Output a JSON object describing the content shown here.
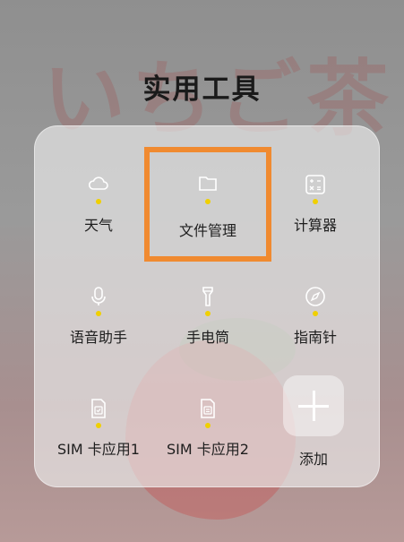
{
  "wallpaper": {
    "text": "いちご茶"
  },
  "folder": {
    "title": "实用工具"
  },
  "apps": [
    {
      "label": "天气",
      "icon": "cloud-icon"
    },
    {
      "label": "文件管理",
      "icon": "folder-icon"
    },
    {
      "label": "计算器",
      "icon": "calculator-icon"
    },
    {
      "label": "语音助手",
      "icon": "microphone-icon"
    },
    {
      "label": "手电筒",
      "icon": "flashlight-icon"
    },
    {
      "label": "指南针",
      "icon": "compass-icon"
    },
    {
      "label": "SIM 卡应用1",
      "icon": "sim-card-icon"
    },
    {
      "label": "SIM 卡应用2",
      "icon": "sim-card-icon"
    }
  ],
  "add": {
    "label": "添加"
  },
  "colors": {
    "highlight": "#f08a30",
    "badge": "#f0d000"
  }
}
